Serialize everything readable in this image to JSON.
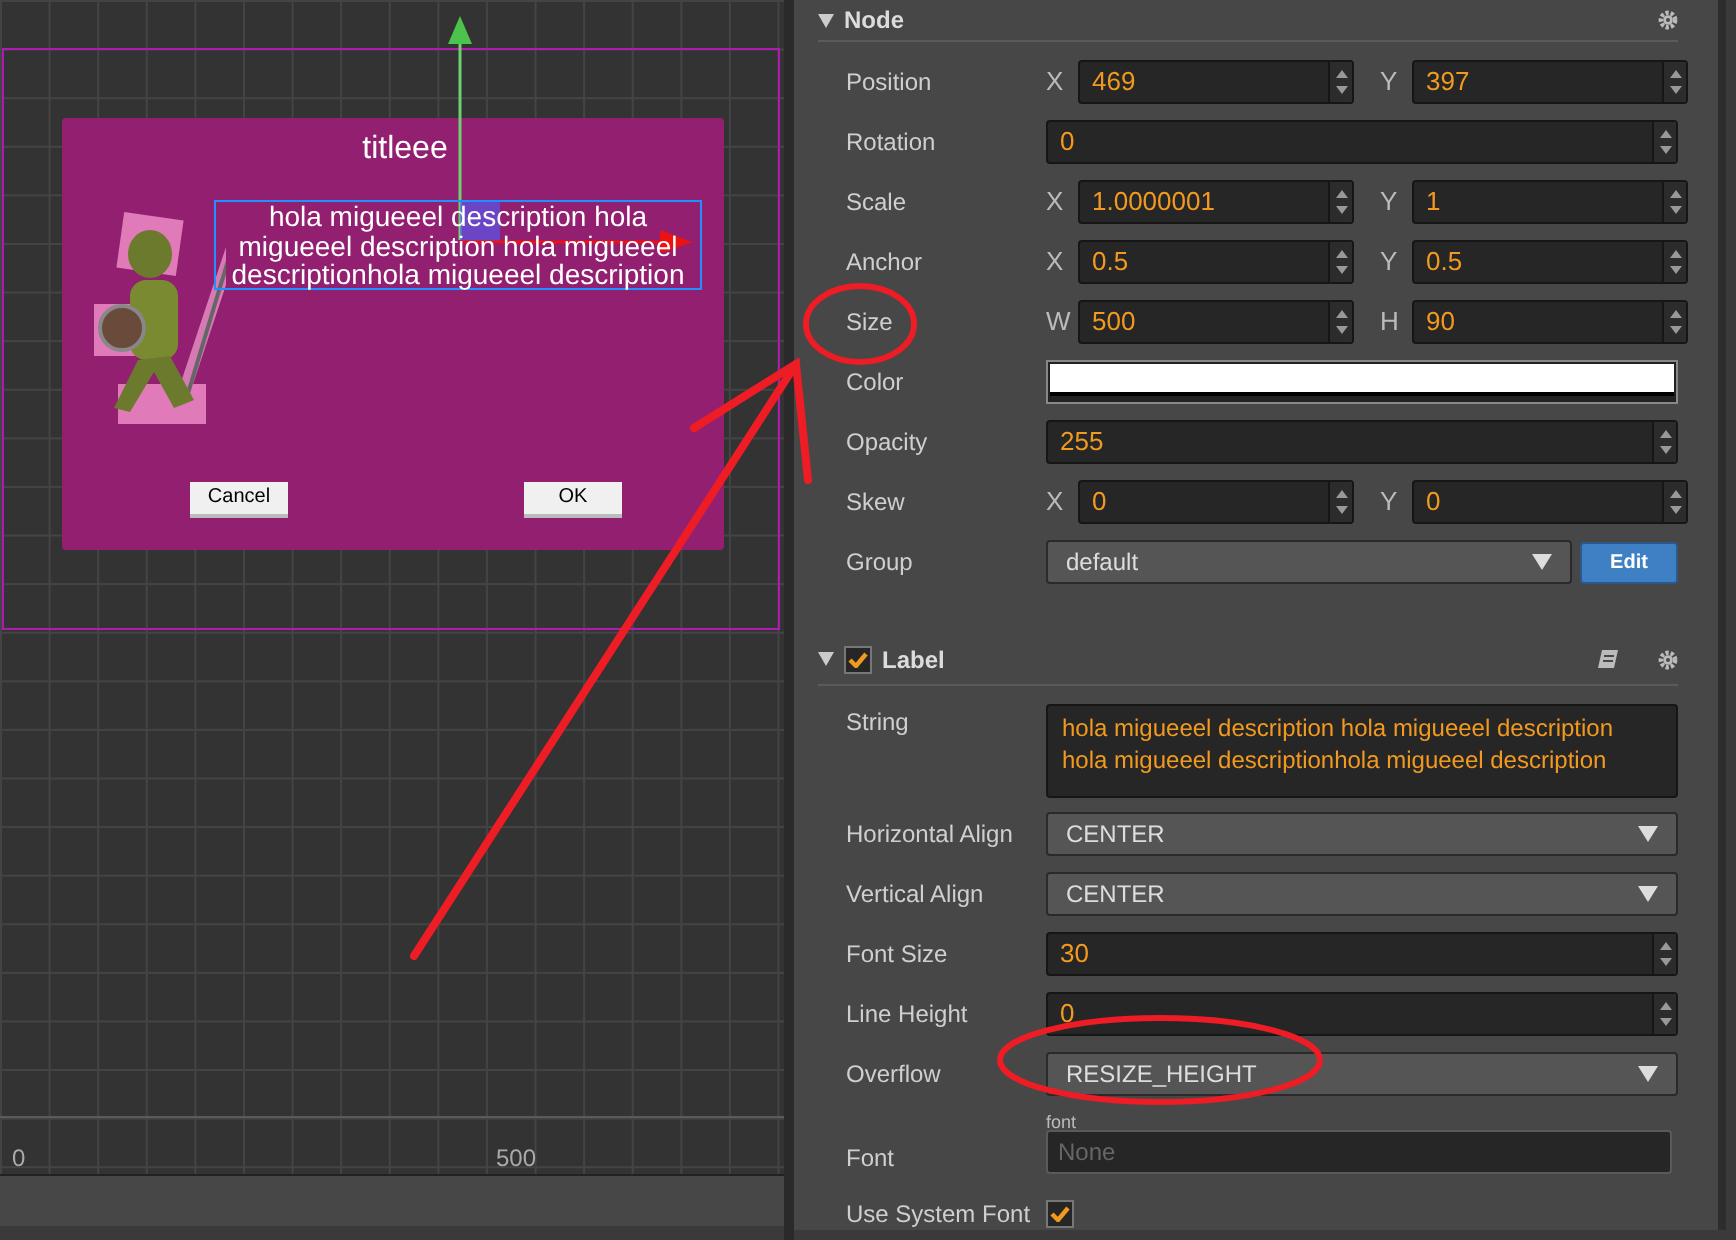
{
  "scene": {
    "dialog": {
      "title": "titleee",
      "description": "hola migueeel description hola migueeel description hola migueeel descriptionhola migueeel description",
      "buttons": [
        "Cancel",
        "OK"
      ]
    },
    "ruler_labels": [
      "0",
      "500"
    ]
  },
  "inspector": {
    "sections": [
      {
        "title": "Node",
        "expanded": true,
        "rows": [
          {
            "kind": "pair",
            "label": "Position",
            "fields": [
              {
                "axis": "X",
                "value": "469"
              },
              {
                "axis": "Y",
                "value": "397"
              }
            ]
          },
          {
            "kind": "number",
            "label": "Rotation",
            "value": "0"
          },
          {
            "kind": "pair",
            "label": "Scale",
            "fields": [
              {
                "axis": "X",
                "value": "1.0000001"
              },
              {
                "axis": "Y",
                "value": "1"
              }
            ]
          },
          {
            "kind": "pair",
            "label": "Anchor",
            "fields": [
              {
                "axis": "X",
                "value": "0.5"
              },
              {
                "axis": "Y",
                "value": "0.5"
              }
            ]
          },
          {
            "kind": "pair",
            "label": "Size",
            "fields": [
              {
                "axis": "W",
                "value": "500"
              },
              {
                "axis": "H",
                "value": "90"
              }
            ]
          },
          {
            "kind": "color",
            "label": "Color",
            "color": "#ffffff"
          },
          {
            "kind": "number",
            "label": "Opacity",
            "value": "255"
          },
          {
            "kind": "pair",
            "label": "Skew",
            "fields": [
              {
                "axis": "X",
                "value": "0"
              },
              {
                "axis": "Y",
                "value": "0"
              }
            ]
          },
          {
            "kind": "select",
            "label": "Group",
            "value": "default",
            "button": "Edit"
          }
        ]
      },
      {
        "title": "Label",
        "expanded": true,
        "enabled": true,
        "rows": [
          {
            "kind": "textarea",
            "label": "String",
            "value": "hola migueeel description hola migueeel description hola migueeel descriptionhola migueeel description"
          },
          {
            "kind": "select",
            "label": "Horizontal Align",
            "value": "CENTER"
          },
          {
            "kind": "select",
            "label": "Vertical Align",
            "value": "CENTER"
          },
          {
            "kind": "number",
            "label": "Font Size",
            "value": "30"
          },
          {
            "kind": "number",
            "label": "Line Height",
            "value": "0"
          },
          {
            "kind": "select",
            "label": "Overflow",
            "value": "RESIZE_HEIGHT"
          },
          {
            "kind": "asset",
            "label": "Font",
            "tag": "font",
            "placeholder": "None"
          },
          {
            "kind": "checkbox",
            "label": "Use System Font",
            "checked": true
          }
        ]
      }
    ]
  }
}
